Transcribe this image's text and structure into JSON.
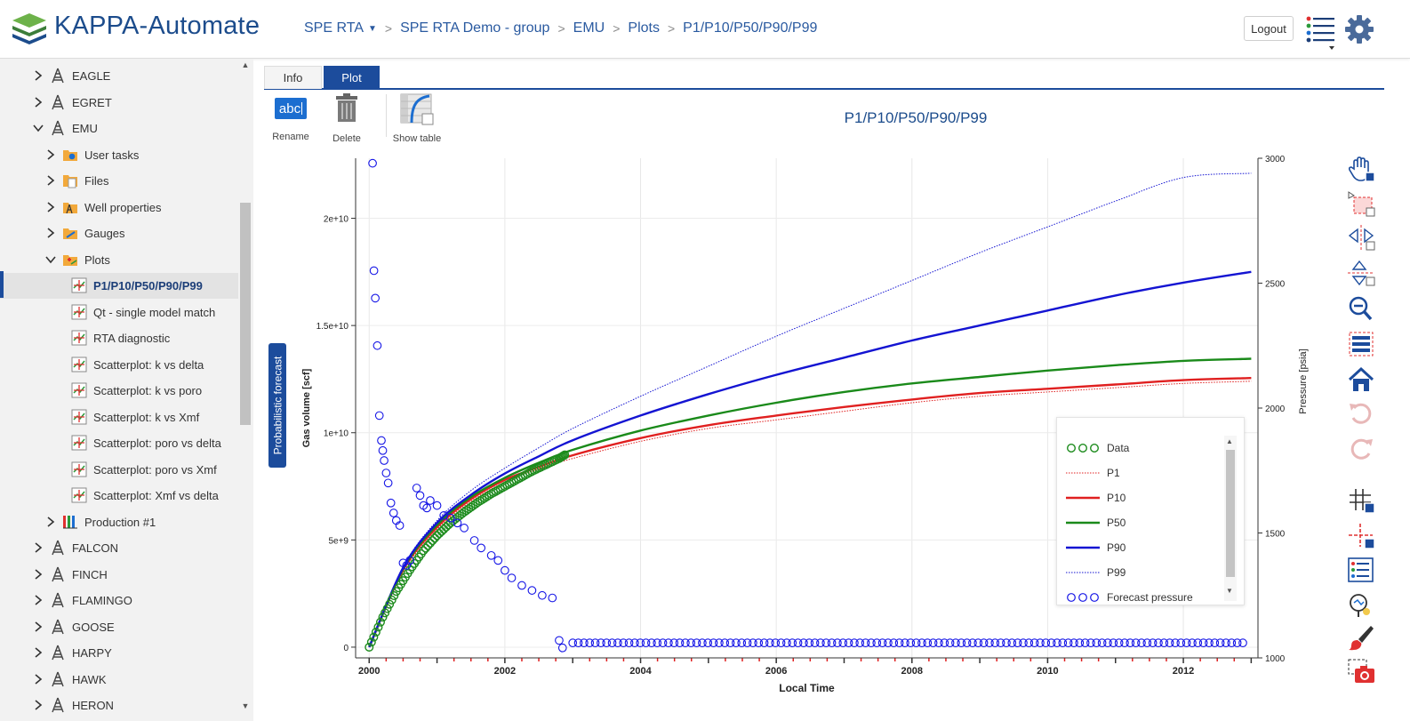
{
  "app": {
    "title": "KAPPA-Automate"
  },
  "breadcrumb": [
    {
      "label": "SPE RTA",
      "has_dropdown": true
    },
    {
      "label": "SPE RTA Demo - group"
    },
    {
      "label": "EMU"
    },
    {
      "label": "Plots"
    },
    {
      "label": "P1/P10/P50/P90/P99"
    }
  ],
  "header": {
    "logout_label": "Logout",
    "icons": [
      "tasks-list-icon",
      "gear-icon"
    ]
  },
  "sidebar": {
    "items": [
      {
        "label": "EAGLE",
        "icon": "well-icon",
        "state": "collapsed"
      },
      {
        "label": "EGRET",
        "icon": "well-icon",
        "state": "collapsed"
      },
      {
        "label": "EMU",
        "icon": "well-icon",
        "state": "expanded"
      },
      {
        "label": "User tasks",
        "icon": "user-tasks-folder-icon",
        "state": "collapsed"
      },
      {
        "label": "Files",
        "icon": "files-folder-icon",
        "state": "collapsed"
      },
      {
        "label": "Well properties",
        "icon": "well-properties-folder-icon",
        "state": "collapsed"
      },
      {
        "label": "Gauges",
        "icon": "gauges-folder-icon",
        "state": "collapsed"
      },
      {
        "label": "Plots",
        "icon": "plots-folder-icon",
        "state": "expanded"
      },
      {
        "label": "P1/P10/P50/P90/P99",
        "icon": "plot-icon",
        "state": "leaf",
        "selected": true
      },
      {
        "label": "Qt - single model match",
        "icon": "plot-icon",
        "state": "leaf"
      },
      {
        "label": "RTA diagnostic",
        "icon": "plot-icon",
        "state": "leaf"
      },
      {
        "label": "Scatterplot: k vs delta",
        "icon": "plot-icon",
        "state": "leaf"
      },
      {
        "label": "Scatterplot: k vs poro",
        "icon": "plot-icon",
        "state": "leaf"
      },
      {
        "label": "Scatterplot: k vs Xmf",
        "icon": "plot-icon",
        "state": "leaf"
      },
      {
        "label": "Scatterplot: poro vs delta",
        "icon": "plot-icon",
        "state": "leaf"
      },
      {
        "label": "Scatterplot: poro vs Xmf",
        "icon": "plot-icon",
        "state": "leaf"
      },
      {
        "label": "Scatterplot: Xmf vs delta",
        "icon": "plot-icon",
        "state": "leaf"
      },
      {
        "label": "Production #1",
        "icon": "production-icon",
        "state": "collapsed"
      },
      {
        "label": "FALCON",
        "icon": "well-icon",
        "state": "collapsed"
      },
      {
        "label": "FINCH",
        "icon": "well-icon",
        "state": "collapsed"
      },
      {
        "label": "FLAMINGO",
        "icon": "well-icon",
        "state": "collapsed"
      },
      {
        "label": "GOOSE",
        "icon": "well-icon",
        "state": "collapsed"
      },
      {
        "label": "HARPY",
        "icon": "well-icon",
        "state": "collapsed"
      },
      {
        "label": "HAWK",
        "icon": "well-icon",
        "state": "collapsed"
      },
      {
        "label": "HERON",
        "icon": "well-icon",
        "state": "collapsed"
      }
    ]
  },
  "tabs": [
    {
      "label": "Info",
      "active": false
    },
    {
      "label": "Plot",
      "active": true
    }
  ],
  "toolbar": {
    "rename_label": "Rename",
    "rename_icon_text": "abc",
    "delete_label": "Delete",
    "show_table_label": "Show table"
  },
  "plot": {
    "title": "P1/P10/P50/P90/P99",
    "side_tab_label": "Probabilistic forecast"
  },
  "right_toolbar": [
    "pan-icon",
    "box-select-icon",
    "x-zoom-icon",
    "y-zoom-icon",
    "zoom-out-icon",
    "legend-table-icon",
    "home-icon",
    "undo-icon",
    "redo-icon",
    "grid-icon",
    "crosshair-icon",
    "legend-icon",
    "hover-tooltip-icon",
    "style-brush-icon",
    "screenshot-icon"
  ],
  "chart_data": {
    "type": "line",
    "title": "P1/P10/P50/P90/P99",
    "xlabel": "Local Time",
    "ylabel": "Gas volume [scf]",
    "y2label": "Pressure [psia]",
    "xlim": [
      1999.8,
      2013.1
    ],
    "ylim": [
      -500000000.0,
      22800000000.0
    ],
    "y2lim": [
      1000,
      3000
    ],
    "x_ticks": [
      "2000",
      "2002",
      "2004",
      "2006",
      "2008",
      "2010",
      "2012"
    ],
    "y_ticks": [
      "0",
      "5e+9",
      "1e+10",
      "1.5e+10",
      "2e+10"
    ],
    "y2_ticks": [
      "1000",
      "1500",
      "2000",
      "2500",
      "3000"
    ],
    "grid": true,
    "legend_position": "bottom-right",
    "legend": [
      "Data",
      "P1",
      "P10",
      "P50",
      "P90",
      "P99",
      "Forecast pressure"
    ],
    "colors": {
      "Data": "#1e8c1e",
      "P1": "#e02020",
      "P10": "#e02020",
      "P50": "#1a8a1a",
      "P90": "#1414d2",
      "P99": "#1414d2",
      "Forecast pressure": "#1414e6"
    },
    "x": [
      2000.0,
      2000.5,
      2001.0,
      2001.5,
      2002.0,
      2002.5,
      2003.0,
      2004.0,
      2005.0,
      2006.0,
      2007.0,
      2008.0,
      2009.0,
      2010.0,
      2011.0,
      2012.0,
      2013.0
    ],
    "series": [
      {
        "name": "P1",
        "style": "dotted",
        "values": [
          0.0,
          3500000000.0,
          5500000000.0,
          6800000000.0,
          7700000000.0,
          8300000000.0,
          8800000000.0,
          9600000000.0,
          10200000000.0,
          10600000000.0,
          11000000000.0,
          11400000000.0,
          11700000000.0,
          11900000000.0,
          12100000000.0,
          12300000000.0,
          12400000000.0
        ]
      },
      {
        "name": "P10",
        "style": "solid",
        "values": [
          0.0,
          3600000000.0,
          5600000000.0,
          6900000000.0,
          7800000000.0,
          8400000000.0,
          8950000000.0,
          9750000000.0,
          10350000000.0,
          10800000000.0,
          11200000000.0,
          11550000000.0,
          11850000000.0,
          12050000000.0,
          12250000000.0,
          12450000000.0,
          12550000000.0
        ]
      },
      {
        "name": "P50",
        "style": "solid",
        "values": [
          0.0,
          3650000000.0,
          5700000000.0,
          7000000000.0,
          7900000000.0,
          8600000000.0,
          9200000000.0,
          10100000000.0,
          10800000000.0,
          11400000000.0,
          11900000000.0,
          12300000000.0,
          12600000000.0,
          12900000000.0,
          13150000000.0,
          13350000000.0,
          13450000000.0
        ]
      },
      {
        "name": "P90",
        "style": "solid",
        "values": [
          0.0,
          3700000000.0,
          5800000000.0,
          7100000000.0,
          8100000000.0,
          8900000000.0,
          9650000000.0,
          10800000000.0,
          11800000000.0,
          12700000000.0,
          13500000000.0,
          14300000000.0,
          15000000000.0,
          15700000000.0,
          16400000000.0,
          17000000000.0,
          17500000000.0
        ]
      },
      {
        "name": "P99",
        "style": "dotted",
        "values": [
          0.0,
          3750000000.0,
          5900000000.0,
          7300000000.0,
          8350000000.0,
          9300000000.0,
          10200000000.0,
          11700000000.0,
          13100000000.0,
          14500000000.0,
          15800000000.0,
          17100000000.0,
          18400000000.0,
          19600000000.0,
          20800000000.0,
          21900000000.0,
          22100000000.0
        ]
      }
    ],
    "data_points": {
      "name": "Data",
      "x": [
        2000.0,
        2000.2,
        2000.4,
        2000.6,
        2000.8,
        2001.0,
        2001.2,
        2001.4,
        2001.6,
        2001.8,
        2002.0,
        2002.2,
        2002.4,
        2002.6,
        2002.8,
        2002.9
      ],
      "values": [
        0.0,
        1400000000.0,
        2600000000.0,
        3600000000.0,
        4500000000.0,
        5200000000.0,
        5800000000.0,
        6300000000.0,
        6750000000.0,
        7150000000.0,
        7500000000.0,
        7850000000.0,
        8200000000.0,
        8500000000.0,
        8800000000.0,
        9000000000.0
      ]
    },
    "forecast_pressure": {
      "name": "Forecast pressure",
      "x": [
        2000.05,
        2000.07,
        2000.09,
        2000.12,
        2000.15,
        2000.18,
        2000.2,
        2000.22,
        2000.25,
        2000.28,
        2000.32,
        2000.36,
        2000.4,
        2000.45,
        2000.5,
        2000.55,
        2000.6,
        2000.7,
        2000.75,
        2000.8,
        2000.85,
        2000.9,
        2001.0,
        2001.1,
        2001.2,
        2001.3,
        2001.4,
        2001.55,
        2001.65,
        2001.8,
        2001.9,
        2002.0,
        2002.1,
        2002.25,
        2002.4,
        2002.55,
        2002.7,
        2002.8,
        2002.85
      ],
      "values": [
        2980,
        2550,
        2440,
        2250,
        1970,
        1870,
        1830,
        1790,
        1740,
        1700,
        1620,
        1580,
        1550,
        1530,
        1380,
        1370,
        1390,
        1680,
        1650,
        1610,
        1600,
        1630,
        1610,
        1570,
        1560,
        1540,
        1520,
        1470,
        1440,
        1410,
        1390,
        1350,
        1320,
        1290,
        1270,
        1250,
        1240,
        1070,
        1040
      ],
      "plateau_value": 1060,
      "plateau_x": [
        2003.0,
        2012.9
      ]
    }
  }
}
